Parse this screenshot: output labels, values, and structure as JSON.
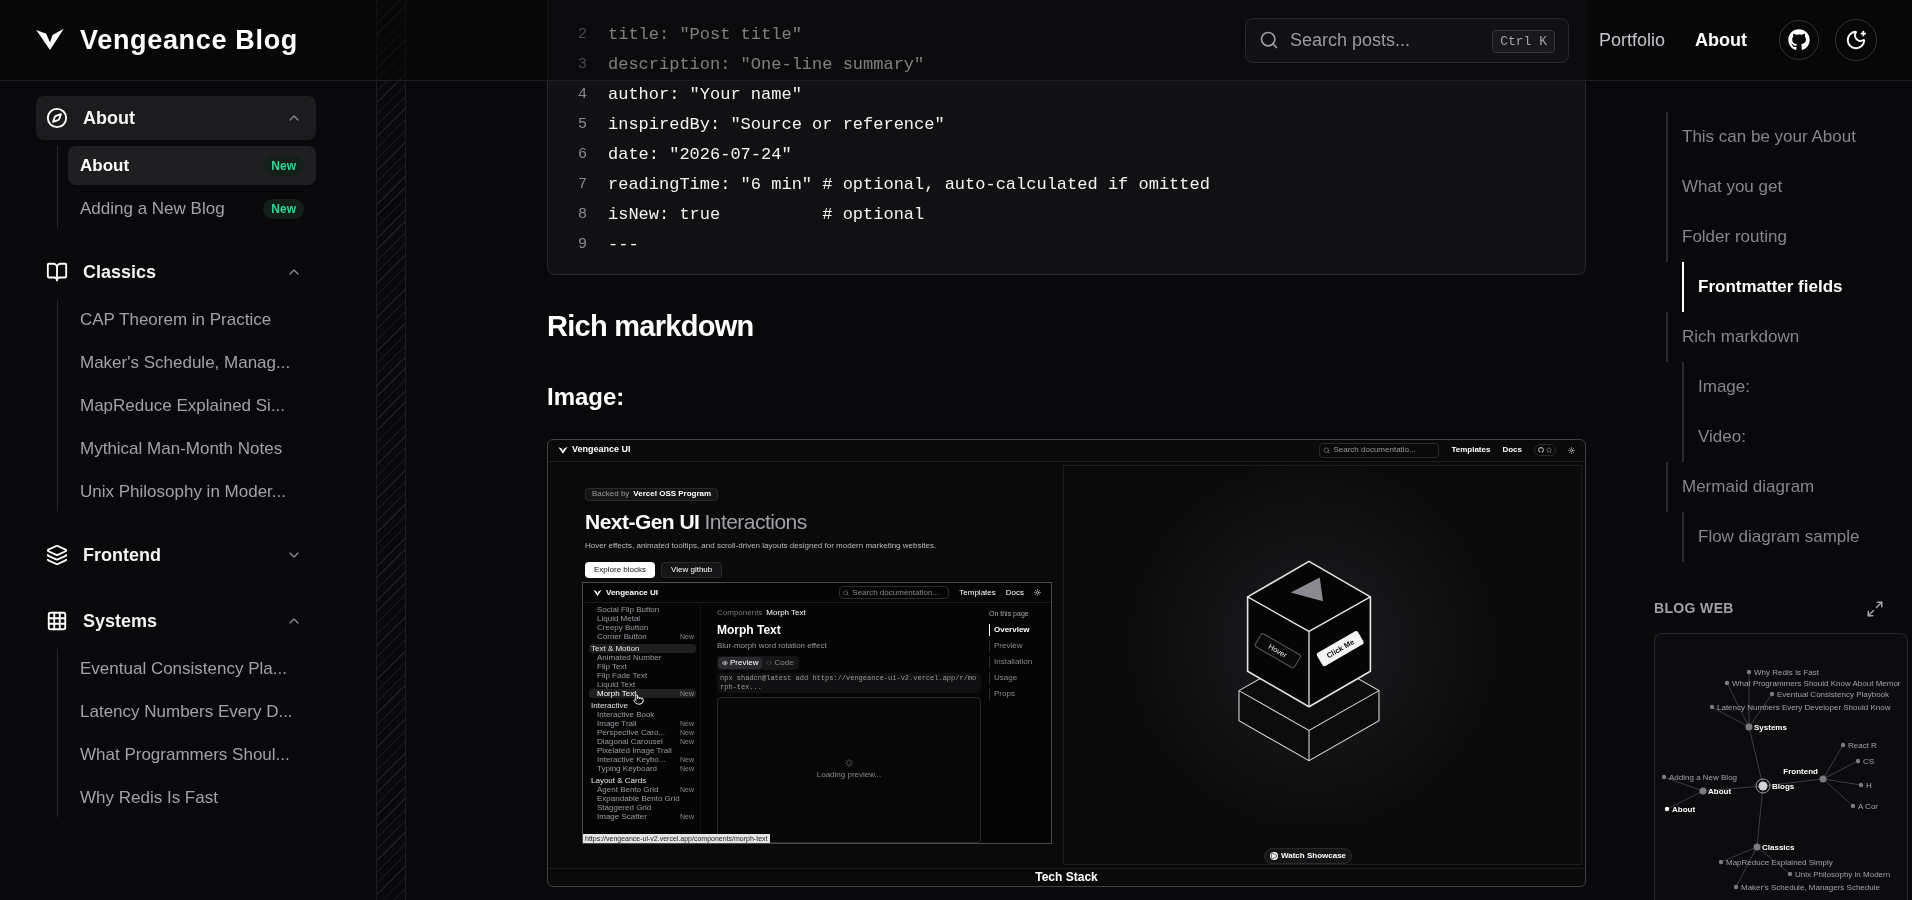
{
  "header": {
    "logo": "Vengeance Blog",
    "search": {
      "placeholder": "Search posts...",
      "shortcut": "Ctrl K"
    },
    "nav": [
      {
        "label": "Portfolio",
        "selected": false
      },
      {
        "label": "About",
        "selected": true
      }
    ]
  },
  "sidebar": {
    "groups": [
      {
        "label": "About",
        "expanded": true,
        "selected": true,
        "children": [
          {
            "label": "About",
            "badge": "New",
            "selected": true
          },
          {
            "label": "Adding a New Blog",
            "badge": "New",
            "selected": false
          }
        ]
      },
      {
        "label": "Classics",
        "expanded": true,
        "selected": false,
        "children": [
          {
            "label": "CAP Theorem in Practice",
            "selected": false
          },
          {
            "label": "Maker's Schedule, Manag...",
            "selected": false
          },
          {
            "label": "MapReduce Explained Si...",
            "selected": false
          },
          {
            "label": "Mythical Man-Month Notes",
            "selected": false
          },
          {
            "label": "Unix Philosophy in Moder...",
            "selected": false
          }
        ]
      },
      {
        "label": "Frontend",
        "expanded": false,
        "selected": false
      },
      {
        "label": "Systems",
        "expanded": true,
        "selected": false,
        "children": [
          {
            "label": "Eventual Consistency Pla...",
            "selected": false
          },
          {
            "label": "Latency Numbers Every D...",
            "selected": false
          },
          {
            "label": "What Programmers Shoul...",
            "selected": false
          },
          {
            "label": "Why Redis Is Fast",
            "selected": false
          }
        ]
      }
    ]
  },
  "code": {
    "lines": [
      {
        "number": "2",
        "text": "title: \"Post title\""
      },
      {
        "number": "3",
        "text": "description: \"One-line summary\""
      },
      {
        "number": "4",
        "text": "author: \"Your name\""
      },
      {
        "number": "5",
        "text": "inspiredBy: \"Source or reference\""
      },
      {
        "number": "6",
        "text": "date: \"2026-07-24\""
      },
      {
        "number": "7",
        "text": "readingTime: \"6 min\" # optional, auto-calculated if omitted"
      },
      {
        "number": "8",
        "text": "isNew: true          # optional"
      },
      {
        "number": "9",
        "text": "---"
      }
    ]
  },
  "sections": [
    {
      "kind": "h2",
      "text": "Rich markdown"
    },
    {
      "kind": "h3",
      "text": "Image:"
    }
  ],
  "image": {
    "brand": "Vengeance UI",
    "search_placeholder": "Search documentatio...",
    "nav": [
      "Templates",
      "Docs"
    ],
    "hero": {
      "badge_prefix": "Backed by",
      "badge": "Vercel OSS Program",
      "title": "Next-Gen UI",
      "title_accent": "Interactions",
      "description": "Hover effects, animated tooltips, and scroll-driven layouts designed for modern marketing websites.",
      "buttons": [
        {
          "label": "Explore blocks",
          "kind": "primary"
        },
        {
          "label": "View github",
          "kind": "secondary"
        }
      ]
    },
    "nested": {
      "brand": "Vengeance UI",
      "search_placeholder": "Search documentation...",
      "nav": [
        "Templates",
        "Docs"
      ],
      "sidebar": [
        {
          "kind": "item",
          "label": "Social Flip Button",
          "selected": false
        },
        {
          "kind": "item",
          "label": "Liquid Metal",
          "selected": false
        },
        {
          "kind": "item",
          "label": "Creepy Button",
          "selected": false
        },
        {
          "kind": "item",
          "label": "Corner Button",
          "badge": "New",
          "selected": false
        },
        {
          "kind": "group",
          "label": "Text & Motion",
          "selected": true
        },
        {
          "kind": "item",
          "label": "Animated Number",
          "selected": false
        },
        {
          "kind": "item",
          "label": "Flip Text",
          "selected": false
        },
        {
          "kind": "item",
          "label": "Flip Fade Text",
          "selected": false
        },
        {
          "kind": "item",
          "label": "Liquid Text",
          "selected": false
        },
        {
          "kind": "item",
          "label": "Morph Text",
          "badge": "New",
          "selected": true
        },
        {
          "kind": "group",
          "label": "Interactive",
          "selected": false
        },
        {
          "kind": "item",
          "label": "Interactive Book",
          "selected": false
        },
        {
          "kind": "item",
          "label": "Image Trail",
          "badge": "New",
          "selected": false
        },
        {
          "kind": "item",
          "label": "Perspective Caro...",
          "badge": "New",
          "selected": false
        },
        {
          "kind": "item",
          "label": "Diagonal Carousel",
          "badge": "New",
          "selected": false
        },
        {
          "kind": "item",
          "label": "Pixelated Image Trail",
          "selected": false
        },
        {
          "kind": "item",
          "label": "Interactive Keybo...",
          "badge": "New",
          "selected": false
        },
        {
          "kind": "item",
          "label": "Typing Keyboard",
          "badge": "New",
          "selected": false
        },
        {
          "kind": "group",
          "label": "Layout & Cards",
          "selected": false
        },
        {
          "kind": "item",
          "label": "Agent Bento Grid",
          "badge": "New",
          "selected": false
        },
        {
          "kind": "item",
          "label": "Expandable Bento Grid",
          "selected": false
        },
        {
          "kind": "item",
          "label": "Staggered Grid",
          "selected": false
        },
        {
          "kind": "item",
          "label": "Image Scatter",
          "badge": "New",
          "selected": false
        }
      ],
      "breadcrumb": [
        "Components",
        "Morph Text"
      ],
      "title": "Morph Text",
      "subtitle": "Blur-morph word rotation effect",
      "tabs": [
        {
          "label": "Preview",
          "selected": true
        },
        {
          "label": "Code",
          "selected": false
        }
      ],
      "command": "npx shadcn@latest add https://vengeance-ui-v2.vercel.app/r/morph-tex...",
      "loading": "Loading preview...",
      "toc_title": "On this page",
      "toc": [
        {
          "label": "Overview",
          "selected": true
        },
        {
          "label": "Preview",
          "selected": false
        },
        {
          "label": "Installation",
          "selected": false
        },
        {
          "label": "Usage",
          "selected": false
        },
        {
          "label": "Props",
          "selected": false
        }
      ],
      "status_url": "https://vengeance-ui-v2.vercel.app/components/morph-text"
    },
    "cube_faces": [
      "Hover",
      "Click Me"
    ],
    "showcase_button": "Watch Showcase",
    "caption": "Tech Stack"
  },
  "toc": {
    "items": [
      {
        "label": "This can be your About",
        "selected": false
      },
      {
        "label": "What you get",
        "selected": false
      },
      {
        "label": "Folder routing",
        "selected": false,
        "children": [
          {
            "label": "Frontmatter fields",
            "selected": true
          }
        ]
      },
      {
        "label": "Rich markdown",
        "selected": false,
        "children": [
          {
            "label": "Image:",
            "selected": false
          },
          {
            "label": "Video:",
            "selected": false
          }
        ]
      },
      {
        "label": "Mermaid diagram",
        "selected": false,
        "children": [
          {
            "label": "Flow diagram sample",
            "selected": false
          }
        ]
      }
    ]
  },
  "blog_web": {
    "title": "BLOG WEB",
    "root": {
      "label": "Blogs",
      "kind": "hub",
      "selected": false,
      "children": [
        {
          "label": "Systems",
          "kind": "category",
          "selected": false,
          "children": [
            {
              "label": "Why Redis Is Fast",
              "kind": "post",
              "selected": false
            },
            {
              "label": "What Programmers Should Know About Memor",
              "kind": "post",
              "selected": false
            },
            {
              "label": "Eventual Consistency Playbook",
              "kind": "post",
              "selected": false
            },
            {
              "label": "Latency Numbers Every Developer Should Know",
              "kind": "post",
              "selected": false
            }
          ]
        },
        {
          "label": "About",
          "kind": "category",
          "selected": false,
          "children": [
            {
              "label": "Adding a New Blog",
              "kind": "post",
              "selected": false
            },
            {
              "label": "About",
              "kind": "post",
              "selected": true
            }
          ]
        },
        {
          "label": "Frontend",
          "kind": "category",
          "selected": false,
          "children": [
            {
              "label": "React R",
              "kind": "post",
              "selected": false
            },
            {
              "label": "CS",
              "kind": "post",
              "selected": false
            },
            {
              "label": "H",
              "kind": "post",
              "selected": false
            },
            {
              "label": "A Cor",
              "kind": "post",
              "selected": false
            }
          ]
        },
        {
          "label": "Classics",
          "kind": "category",
          "selected": false,
          "children": [
            {
              "label": "MapReduce Explained Simply",
              "kind": "post",
              "selected": false
            },
            {
              "label": "Unix Philosophy in Modern",
              "kind": "post",
              "selected": false
            },
            {
              "label": "Maker's Schedule, Managers Schedule",
              "kind": "post",
              "selected": false
            }
          ]
        }
      ]
    }
  }
}
